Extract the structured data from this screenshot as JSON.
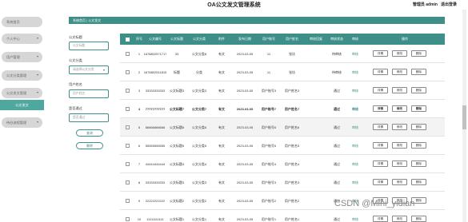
{
  "header": {
    "title": "OA公文发文管理系统",
    "user": "管理员 admin",
    "logout": "退出登录"
  },
  "sidebar": {
    "items": [
      {
        "label": "系统首页",
        "arrow": ""
      },
      {
        "label": "个人中心",
        "arrow": "▾"
      },
      {
        "label": "用户管理",
        "arrow": "▾"
      },
      {
        "label": "公文分类管理",
        "arrow": "▾"
      },
      {
        "label": "公文发文管理",
        "arrow": "▾"
      },
      {
        "label": "公文发文",
        "arrow": ""
      },
      {
        "label": "待办流程管理",
        "arrow": "▾"
      }
    ]
  },
  "breadcrumb": {
    "home": "系统首页",
    "sep": "|",
    "current": "公文发文"
  },
  "filters": {
    "title_label": "公文标题",
    "title_placeholder": "公文标题",
    "category_label": "公文分类",
    "category_placeholder": "请选择公文分类",
    "user_label": "用户姓名",
    "user_placeholder": "用户姓名",
    "pass_label": "是否通过",
    "pass_placeholder": "是否通过",
    "search_button": "查询",
    "delete_button": "删除"
  },
  "table": {
    "headers": [
      "",
      "序号",
      "公文编号",
      "公文标题",
      "公文分类",
      "附件",
      "发布日期",
      "用户账号",
      "用户姓名",
      "审核回复",
      "审核状态",
      "审核",
      "操作"
    ],
    "actions": [
      "详情",
      "修改",
      "删除"
    ],
    "rows": [
      {
        "no": "1",
        "code": "1678802571717",
        "title": "33",
        "category": "公文分类8",
        "file": "有文",
        "date": "2023-03-05",
        "account": "11",
        "name": "张钫",
        "reply": "",
        "status": "待审核",
        "audit": "审核"
      },
      {
        "no": "2",
        "code": "1678802511815",
        "title": "标题",
        "category": "分类",
        "file": "有文",
        "date": "2023-03-05",
        "account": "11",
        "name": "张钫",
        "reply": "",
        "status": "待审核",
        "audit": "审核"
      },
      {
        "no": "3",
        "code": "33333333333",
        "title": "公文标题3",
        "category": "公文分类3",
        "file": "有文",
        "date": "2023-03-05",
        "account": "用户账号3",
        "name": "用户姓名3",
        "reply": "",
        "status": "通过",
        "audit": "审核"
      },
      {
        "no": "4",
        "code": "77777777777",
        "title": "公文标题7",
        "category": "公文分类7",
        "file": "有文",
        "date": "2023-03-05",
        "account": "用户账号7",
        "name": "用户姓名7",
        "reply": "",
        "status": "通过",
        "audit": "审核"
      },
      {
        "no": "5",
        "code": "66666666666",
        "title": "公文标题6",
        "category": "公文分类6",
        "file": "有文",
        "date": "2023-03-05",
        "account": "用户账号6",
        "name": "用户姓名6",
        "reply": "",
        "status": "通过",
        "audit": "审核"
      },
      {
        "no": "6",
        "code": "55555555555",
        "title": "公文标题5",
        "category": "公文分类5",
        "file": "有文",
        "date": "2023-03-05",
        "account": "用户账号5",
        "name": "用户姓名5",
        "reply": "",
        "status": "通过",
        "audit": "审核"
      },
      {
        "no": "7",
        "code": "44444444444",
        "title": "公文标题4",
        "category": "公文分类4",
        "file": "有文",
        "date": "2023-03-05",
        "account": "用户账号4",
        "name": "用户姓名4",
        "reply": "",
        "status": "通过",
        "audit": "审核"
      },
      {
        "no": "8",
        "code": "33333333333",
        "title": "公文标题3",
        "category": "公文分类3",
        "file": "有文",
        "date": "2023-03-05",
        "account": "用户账号3",
        "name": "用户姓名3",
        "reply": "",
        "status": "通过",
        "audit": "审核"
      },
      {
        "no": "9",
        "code": "22222222222",
        "title": "公文标题2",
        "category": "公文分类2",
        "file": "有文",
        "date": "2023-03-05",
        "account": "用户账号2",
        "name": "用户姓名2",
        "reply": "",
        "status": "通过",
        "audit": "审核"
      },
      {
        "no": "10",
        "code": "11111111111",
        "title": "公文标题1",
        "category": "公文分类1",
        "file": "有文",
        "date": "2023-03-05",
        "account": "用户账号1",
        "name": "用户姓名1",
        "reply": "",
        "status": "通过",
        "audit": "审核"
      }
    ]
  },
  "watermark": "CSDN @Mini_yidian",
  "colors": {
    "accent": "#3d8f87",
    "sidebar_item": "#d6d6d6",
    "sidebar_active": "#4ea8a0"
  }
}
